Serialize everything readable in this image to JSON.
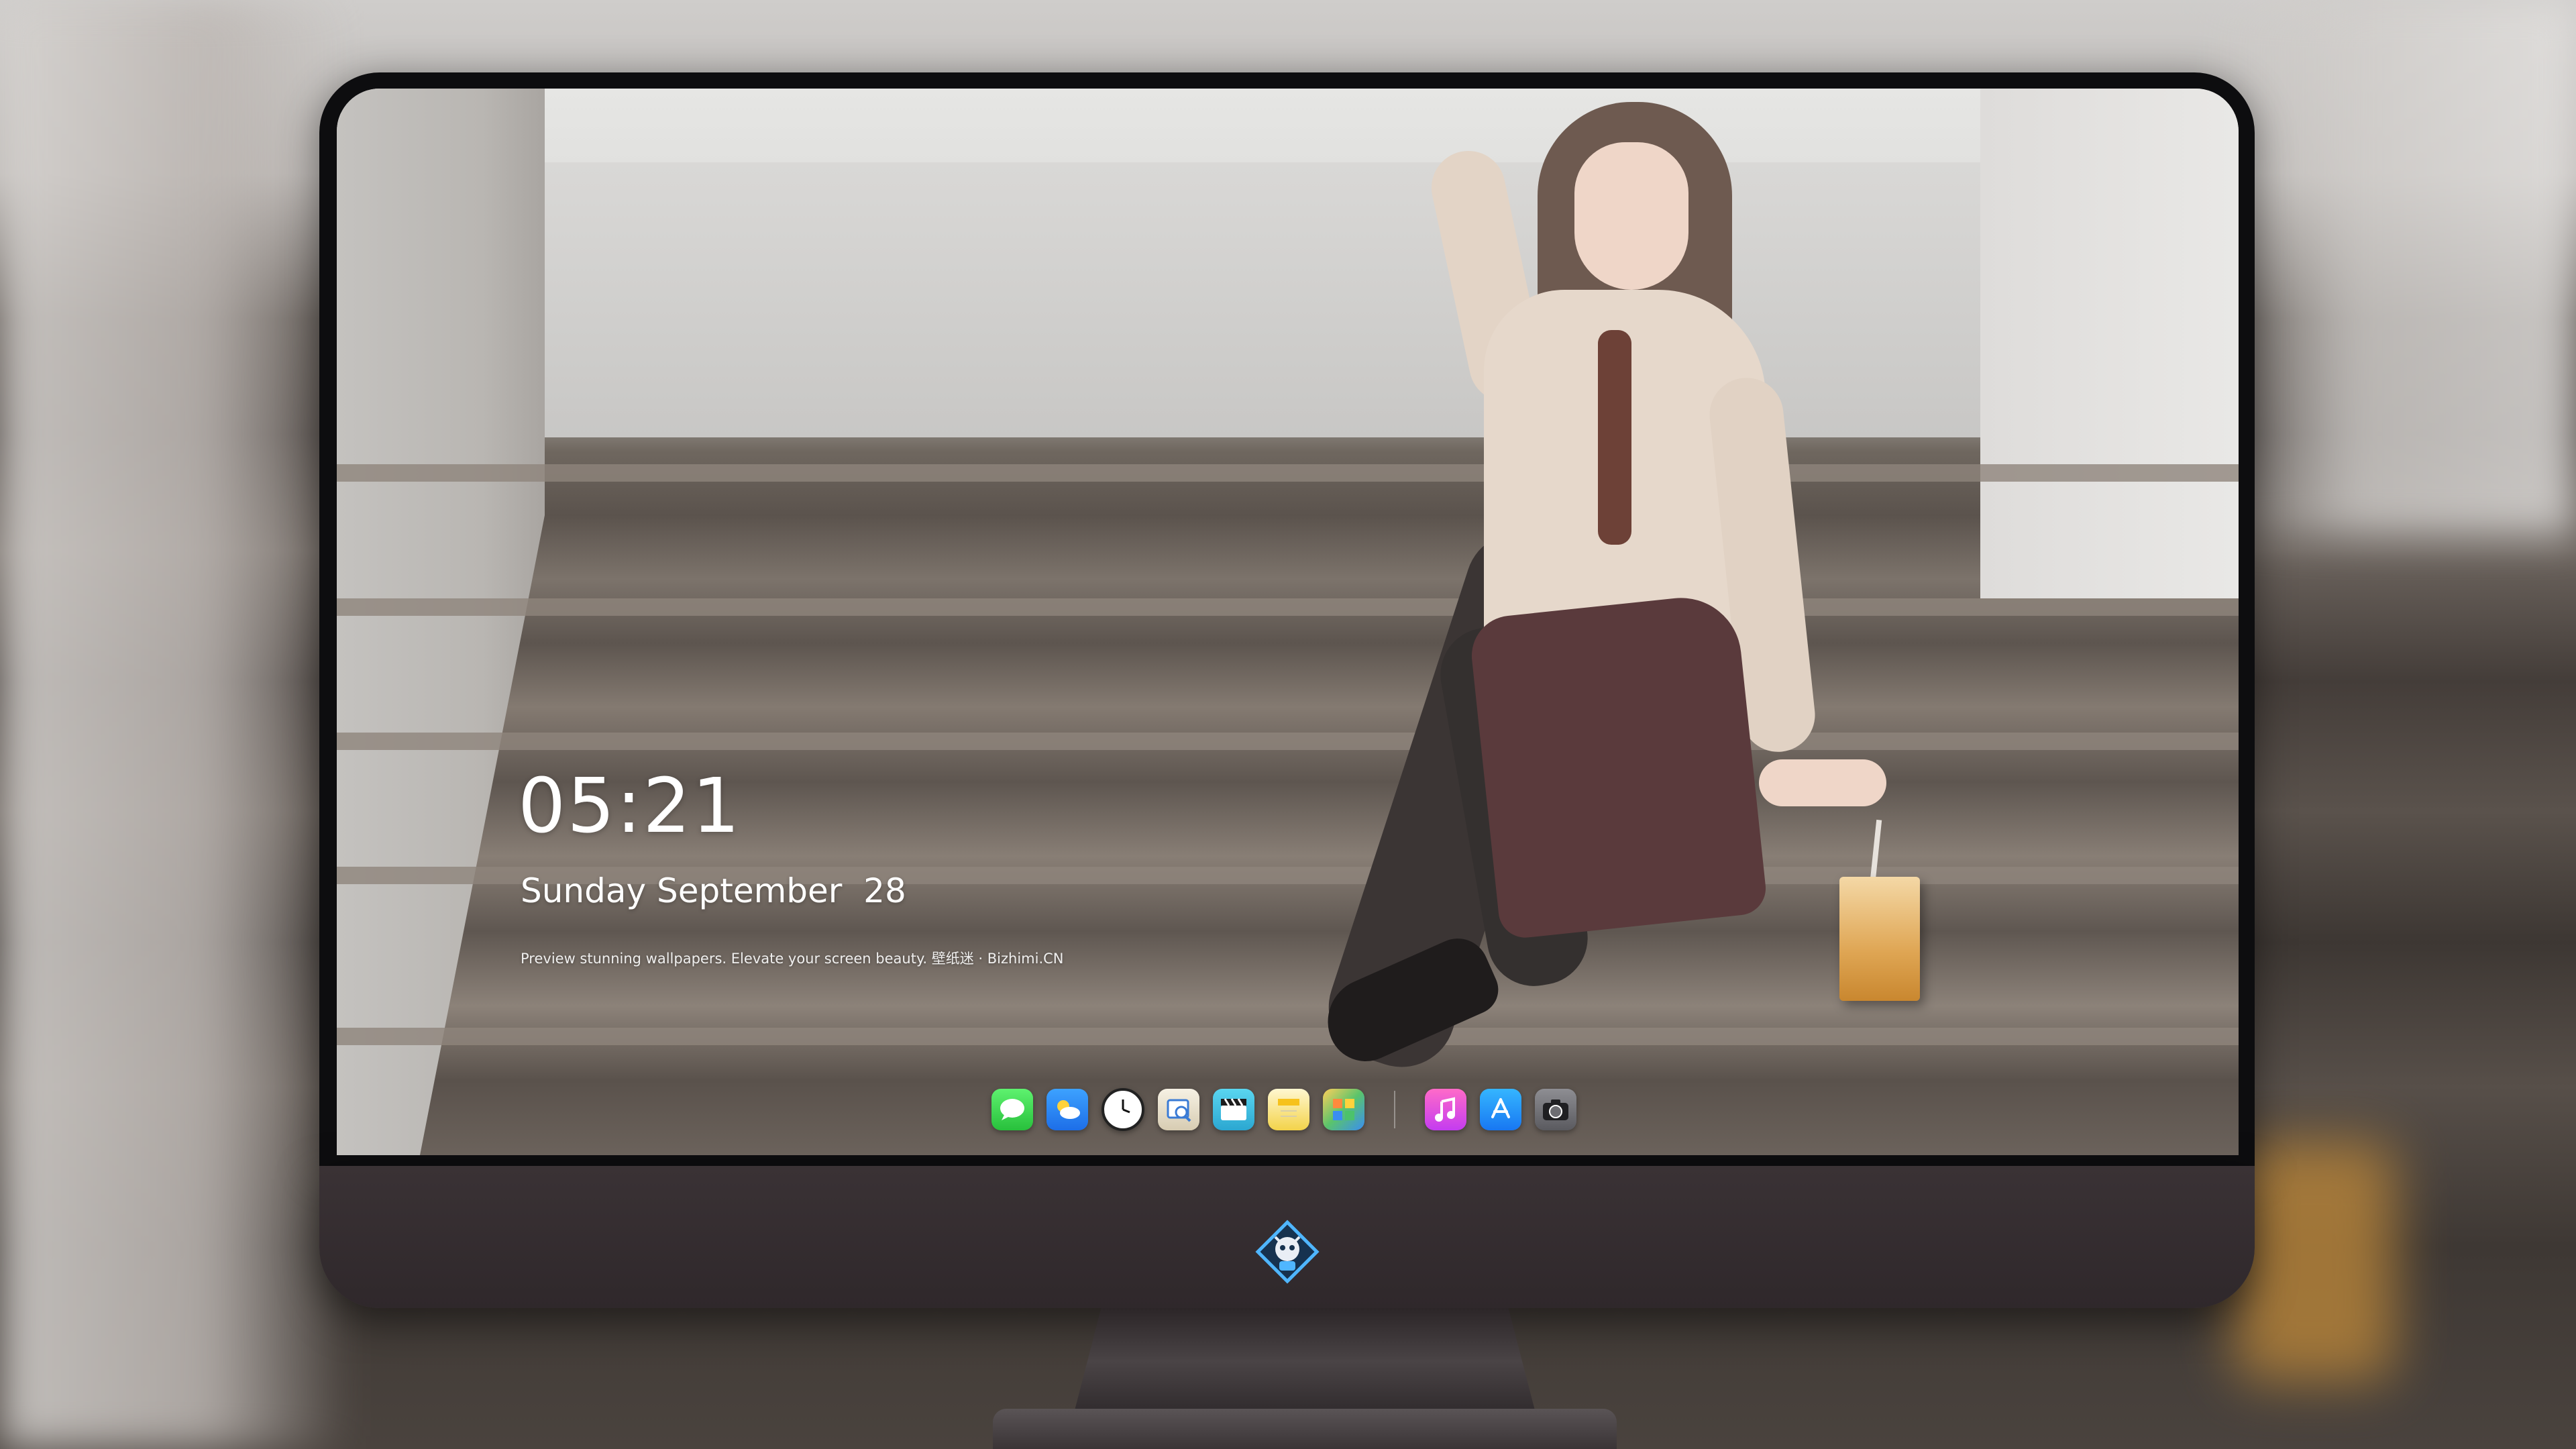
{
  "lock_screen": {
    "time": "05:21",
    "date": "Sunday September  28",
    "tagline": "Preview stunning wallpapers. Elevate your screen beauty. 壁纸迷 · Bizhimi.CN"
  },
  "dock": {
    "apps": [
      {
        "name": "Messages",
        "icon": "messages-icon"
      },
      {
        "name": "Weather",
        "icon": "weather-icon"
      },
      {
        "name": "Clock",
        "icon": "clock-icon"
      },
      {
        "name": "Preview",
        "icon": "preview-icon"
      },
      {
        "name": "Clips",
        "icon": "clapper-icon"
      },
      {
        "name": "Notes",
        "icon": "notes-icon"
      },
      {
        "name": "Photos",
        "icon": "photos-icon"
      },
      {
        "name": "Music",
        "icon": "music-icon"
      },
      {
        "name": "App Store",
        "icon": "app-store-icon"
      },
      {
        "name": "Camera",
        "icon": "camera-icon"
      }
    ]
  },
  "colors": {
    "monitor_chin": "#2f282b",
    "bezel": "#0d0d0f",
    "text": "#ffffff"
  }
}
